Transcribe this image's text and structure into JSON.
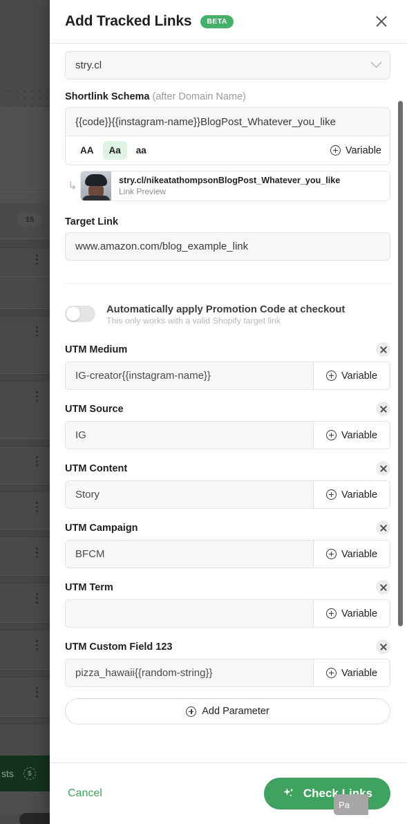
{
  "backdrop": {
    "badge_count": "15",
    "green_bar_text": "sts",
    "coin_icon": "dollar-badge-icon"
  },
  "modal": {
    "title": "Add Tracked Links",
    "badge": "BETA",
    "close_icon": "close-icon"
  },
  "domain": {
    "value": "stry.cl",
    "chevron_icon": "chevron-down-icon"
  },
  "schema": {
    "label": "Shortlink Schema",
    "label_sub": "(after Domain Name)",
    "value": "{{code}}{{instagram-name}}BlogPost_Whatever_you_like",
    "case_options": [
      "AA",
      "Aa",
      "aa"
    ],
    "case_selected": "Aa",
    "variable_label": "Variable",
    "variable_icon": "plus-circle-icon",
    "preview": {
      "arrow_icon": "arrow-branch-icon",
      "avatar_icon": "avatar",
      "url": "stry.cl/nikeatathompsonBlogPost_Whatever_you_like",
      "caption": "Link Preview"
    }
  },
  "target_link": {
    "label": "Target Link",
    "value": "www.amazon.com/blog_example_link"
  },
  "promotion": {
    "toggle_state": "off",
    "title": "Automatically apply Promotion Code at checkout",
    "subtitle": "This only works with a valid Shopify target link"
  },
  "utm_fields": [
    {
      "label": "UTM Medium",
      "value": "IG-creator{{instagram-name}}",
      "variable_label": "Variable",
      "remove_icon": "close-icon"
    },
    {
      "label": "UTM Source",
      "value": "IG",
      "variable_label": "Variable",
      "remove_icon": "close-icon"
    },
    {
      "label": "UTM Content",
      "value": "Story",
      "variable_label": "Variable",
      "remove_icon": "close-icon"
    },
    {
      "label": "UTM Campaign",
      "value": "BFCM",
      "variable_label": "Variable",
      "remove_icon": "close-icon"
    },
    {
      "label": "UTM Term",
      "value": "",
      "variable_label": "Variable",
      "remove_icon": "close-icon"
    },
    {
      "label": "UTM Custom Field 123",
      "value": "pizza_hawaii{{random-string}}",
      "variable_label": "Variable",
      "remove_icon": "close-icon"
    }
  ],
  "add_parameter": {
    "label": "Add Parameter",
    "icon": "plus-circle-icon"
  },
  "footer": {
    "cancel_label": "Cancel",
    "submit_label": "Check Links",
    "submit_icon": "sparkle-icon"
  },
  "side_tab": {
    "label": "Pa"
  },
  "colors": {
    "accent_green": "#3fa35f",
    "badge_green": "#45b06a",
    "case_active_bg": "#dff3e4",
    "field_bg": "#f6f7f8",
    "border": "#e2e2e2",
    "backdrop": "#4a4a4a",
    "green_bar": "#14321f"
  }
}
